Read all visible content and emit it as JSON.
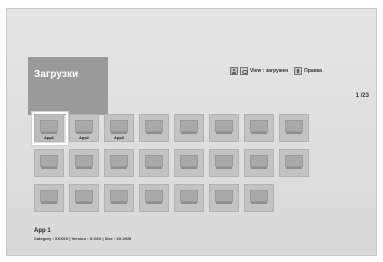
{
  "header": {
    "title": "Загрузки",
    "legend": [
      {
        "icon": "person-icon",
        "label": ""
      },
      {
        "icon": "view-icon",
        "label": "View : загружен"
      },
      {
        "icon": "rights-icon",
        "label": "Правка"
      }
    ],
    "page_indicator": "1 /23"
  },
  "grid": {
    "selected_index": 0,
    "tiles": [
      {
        "label": "App1"
      },
      {
        "label": "App2"
      },
      {
        "label": "App3"
      },
      {
        "label": ""
      },
      {
        "label": ""
      },
      {
        "label": ""
      },
      {
        "label": ""
      },
      {
        "label": ""
      },
      {
        "label": ""
      },
      {
        "label": ""
      },
      {
        "label": ""
      },
      {
        "label": ""
      },
      {
        "label": ""
      },
      {
        "label": ""
      },
      {
        "label": ""
      },
      {
        "label": ""
      },
      {
        "label": ""
      },
      {
        "label": ""
      },
      {
        "label": ""
      },
      {
        "label": ""
      },
      {
        "label": ""
      },
      {
        "label": ""
      },
      {
        "label": ""
      }
    ]
  },
  "info": {
    "name": "App 1",
    "meta": "Category : XXXXX  |  Version : X.XXX  |  Size : XX.XKB"
  }
}
